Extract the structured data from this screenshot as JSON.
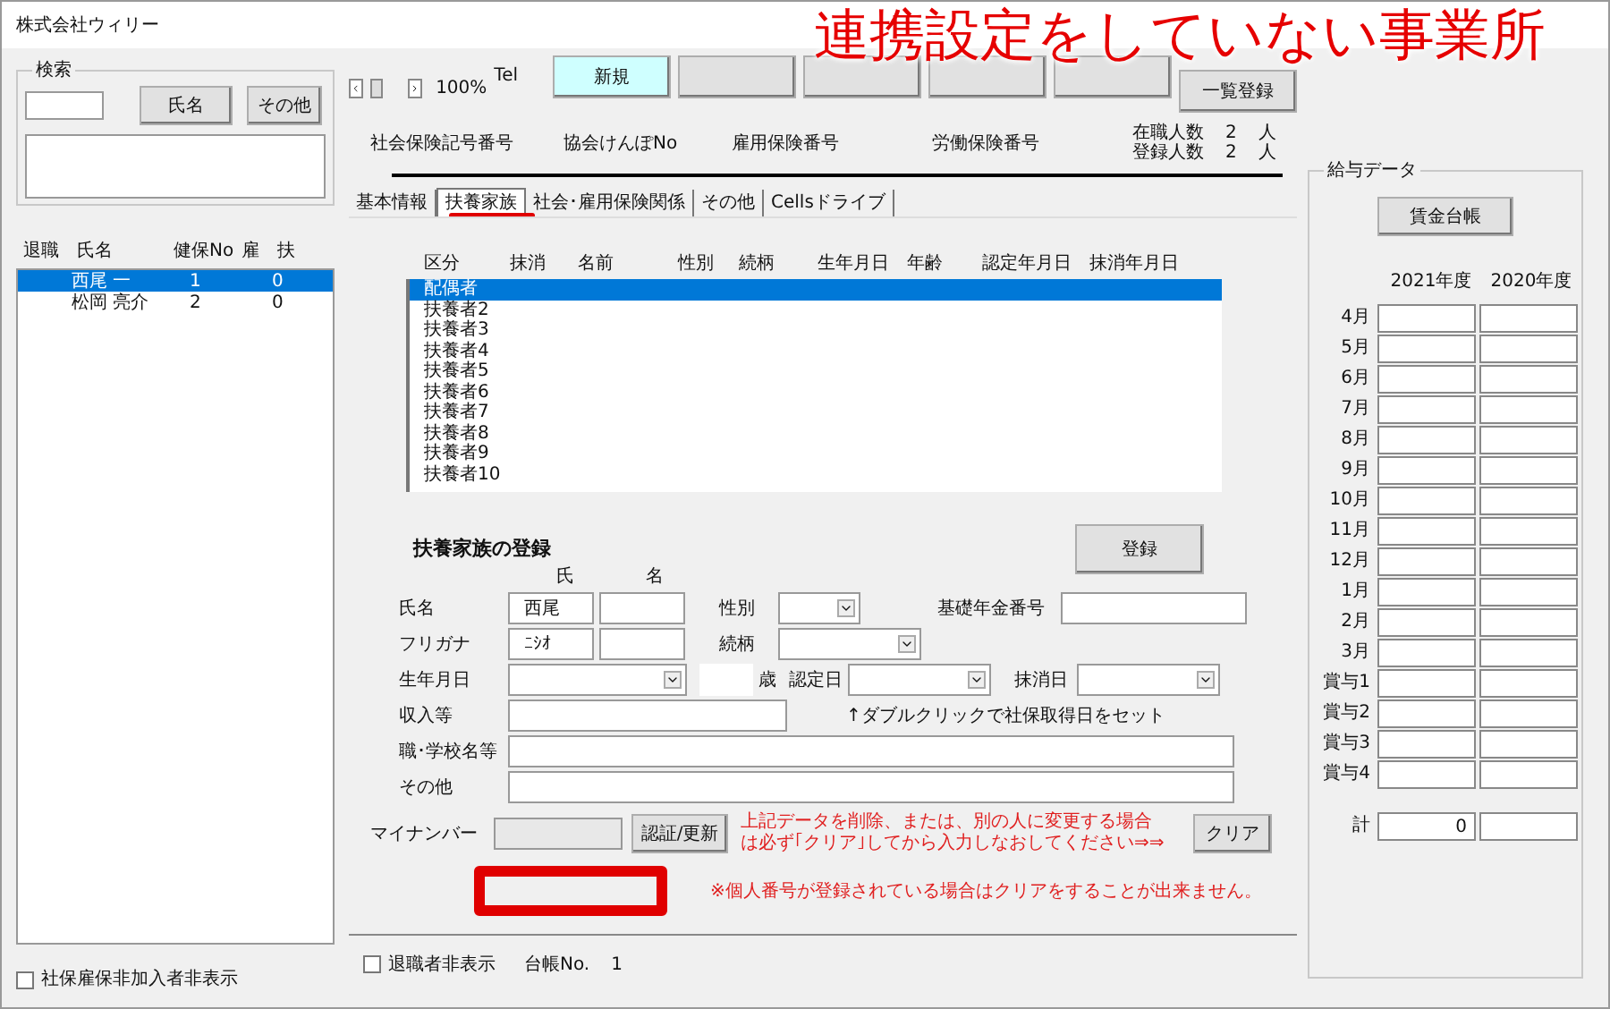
{
  "window": {
    "title": "株式会社ウィリー"
  },
  "annotation": {
    "caption": "連携設定をしていない事業所"
  },
  "search": {
    "title": "検索",
    "buttons": [
      "氏名",
      "その他"
    ]
  },
  "employee_list": {
    "columns": [
      "退職",
      "氏名",
      "健保No",
      "雇",
      "扶"
    ],
    "rows": [
      {
        "cells": [
          "",
          "西尾 一",
          "1",
          "",
          "0"
        ],
        "selected": true
      },
      {
        "cells": [
          "",
          "松岡 亮介",
          "2",
          "",
          "0"
        ],
        "selected": false
      }
    ]
  },
  "left_footer": {
    "label": "社保雇保非加入者非表示",
    "checked": false
  },
  "toolbar": {
    "zoom": "100%",
    "tel_label": "Tel",
    "buttons": [
      {
        "lines": [
          "新規"
        ],
        "highlighted": true
      },
      {
        "highlighted": false
      },
      {
        "highlighted": false
      },
      {
        "highlighted": false
      },
      {
        "highlighted": false
      },
      {
        "lines": [
          "一覧登録"
        ],
        "highlighted": false
      }
    ]
  },
  "info": {
    "labels": [
      "社会保険記号番号",
      "協会けんぽNo",
      "雇用保険番号",
      "労働保険番号"
    ],
    "counts": [
      {
        "label": "在職人数",
        "value": "2",
        "unit": "人"
      },
      {
        "label": "登録人数",
        "value": "2",
        "unit": "人"
      }
    ]
  },
  "tabs": [
    {
      "label": "基本情報",
      "selected": false
    },
    {
      "label": "扶養家族",
      "selected": true
    },
    {
      "label": "社会･雇用保険関係",
      "selected": false
    },
    {
      "label": "その他",
      "selected": false
    },
    {
      "label": "Cellsドライブ",
      "selected": false
    }
  ],
  "dependents": {
    "columns": [
      "区分",
      "抹消",
      "名前",
      "性別",
      "続柄",
      "生年月日",
      "年齢",
      "認定年月日",
      "抹消年月日"
    ],
    "rows": [
      {
        "label": "配偶者",
        "selected": true
      },
      {
        "label": "扶養者2",
        "selected": false
      },
      {
        "label": "扶養者3",
        "selected": false
      },
      {
        "label": "扶養者4",
        "selected": false
      },
      {
        "label": "扶養者5",
        "selected": false
      },
      {
        "label": "扶養者6",
        "selected": false
      },
      {
        "label": "扶養者7",
        "selected": false
      },
      {
        "label": "扶養者8",
        "selected": false
      },
      {
        "label": "扶養者9",
        "selected": false
      },
      {
        "label": "扶養者10",
        "selected": false
      }
    ]
  },
  "form": {
    "title": "扶養家族の登録",
    "register_button": "登録",
    "surname_header": "氏",
    "given_header": "名",
    "name": {
      "label": "氏名",
      "surname": "西尾"
    },
    "kana": {
      "label": "フリガナ",
      "surname": "ﾆｼｵ"
    },
    "gender": {
      "label": "性別"
    },
    "relation": {
      "label": "続柄"
    },
    "pension": {
      "label": "基礎年金番号"
    },
    "birth": {
      "label": "生年月日"
    },
    "age_unit": "歳",
    "certified": {
      "label": "認定日"
    },
    "removed": {
      "label": "抹消日"
    },
    "income": {
      "label": "収入等"
    },
    "hint": "↑ダブルクリックで社保取得日をセット",
    "school": {
      "label": "職･学校名等"
    },
    "other": {
      "label": "その他"
    },
    "mynumber": {
      "label": "マイナンバー",
      "disabled": true
    },
    "auth_button": "認証/更新",
    "warning_lines": [
      "上記データを削除、または、別の人に変更する場合",
      "は必ず｢クリア｣してから入力しなおしてください⇒⇒"
    ],
    "clear_button": "クリア",
    "note": "※個人番号が登録されている場合はクリアをすることが出来ません。"
  },
  "bottom": {
    "retired_hidden": {
      "label": "退職者非表示",
      "checked": false
    },
    "ledger_label": "台帳No.",
    "ledger_no": "1"
  },
  "salary": {
    "title": "給与データ",
    "button": "賃金台帳",
    "years": [
      "2021年度",
      "2020年度"
    ],
    "rows": [
      {
        "label": "4月"
      },
      {
        "label": "5月"
      },
      {
        "label": "6月"
      },
      {
        "label": "7月"
      },
      {
        "label": "8月"
      },
      {
        "label": "9月"
      },
      {
        "label": "10月"
      },
      {
        "label": "11月"
      },
      {
        "label": "12月"
      },
      {
        "label": "1月"
      },
      {
        "label": "2月"
      },
      {
        "label": "3月"
      },
      {
        "label": "賞与1"
      },
      {
        "label": "賞与2"
      },
      {
        "label": "賞与3"
      },
      {
        "label": "賞与4"
      }
    ],
    "total": {
      "label": "計",
      "value": "0"
    }
  }
}
